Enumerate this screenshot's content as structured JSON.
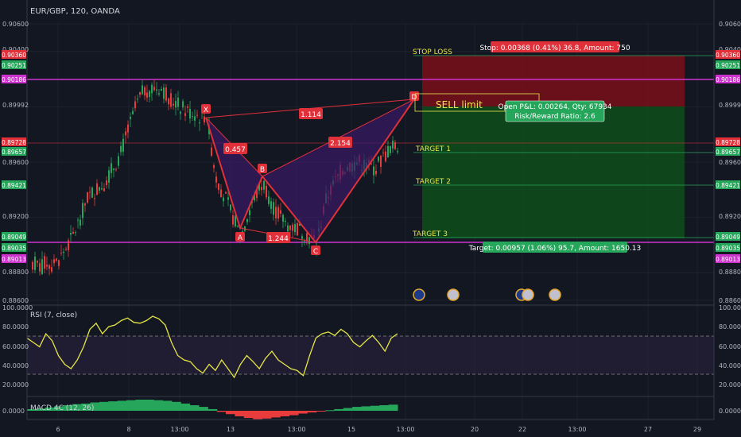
{
  "header": {
    "symbol_title": "EUR/GBP, 120, OANDA"
  },
  "colors": {
    "background": "#131722",
    "up_candle": "#26a65b",
    "down_candle": "#e83c3c",
    "pattern": "#e0303a",
    "pattern_fill": "#3a1a66",
    "magenta": "#cc33cc",
    "stop_zone": "#7a0f1a",
    "target_zone": "#0f4d1a",
    "rsi": "#e6e645",
    "rsi_band": "#2a1f3d",
    "target_text": "#e6e645",
    "grid": "#1e222d"
  },
  "price_axis": {
    "ticks": [
      "0.90600",
      "0.90400",
      "0.89992",
      "0.89600",
      "0.89200",
      "0.88800",
      "0.88600"
    ],
    "left_ticks": [
      "0.90600",
      "0.90400",
      "0.89992",
      "0.89600",
      "0.89200",
      "0.88800",
      "0.88600"
    ],
    "badges": [
      {
        "label": "0.90360",
        "color": "#e0303a",
        "value": 0.9036
      },
      {
        "label": "0.90251",
        "color": "#26a65b",
        "value": 0.90251
      },
      {
        "label": "0.90186",
        "color": "#cc33cc",
        "value": 0.90186
      },
      {
        "label": "0.89728",
        "color": "#e0303a",
        "value": 0.89728
      },
      {
        "label": "0.89657",
        "color": "#26a65b",
        "value": 0.89657
      },
      {
        "label": "0.89421",
        "color": "#26a65b",
        "value": 0.89421
      },
      {
        "label": "0.89049",
        "color": "#26a65b",
        "value": 0.89049
      },
      {
        "label": "0.89035",
        "color": "#26a65b",
        "value": 0.89035
      },
      {
        "label": "0.89013",
        "color": "#cc33cc",
        "value": 0.89013
      }
    ]
  },
  "time_axis": {
    "ticks": [
      "6",
      "8",
      "13:00",
      "13",
      "13:00",
      "15",
      "13:00",
      "20",
      "22",
      "13:00",
      "27",
      "29",
      "13:00"
    ]
  },
  "chart_data": [
    {
      "type": "line",
      "title": "EUR/GBP, 120, OANDA",
      "pattern": {
        "points": [
          {
            "label": "X",
            "x": 12.7,
            "y": 0.8994
          },
          {
            "label": "A",
            "x": 13.3,
            "y": 0.8906
          },
          {
            "label": "B",
            "x": 13.7,
            "y": 0.8945
          },
          {
            "label": "C",
            "x": 15.3,
            "y": 0.8901
          },
          {
            "label": "D",
            "x": 18.3,
            "y": 0.9011
          }
        ],
        "ratios": [
          "1.114",
          "0.457",
          "2.154",
          "1.244"
        ]
      },
      "trade": {
        "order_label": "SELL limit",
        "stop_loss_label": "STOP LOSS",
        "stop_info": "Stop: 0.00368 (0.41%) 36.8, Amount: 750",
        "pnl_info": "Open P&L: 0.00264, Qty: 67934",
        "rr_info": "Risk/Reward Ratio: 2.6",
        "target_info": "Target: 0.00957 (1.06%) 95.7, Amount: 1650.13",
        "target_labels": [
          "TARGET 1",
          "TARGET 2",
          "TARGET 3"
        ]
      },
      "horizontal_levels": [
        0.90186,
        0.89728,
        0.89013
      ]
    },
    {
      "type": "line",
      "title": "RSI (7, close)",
      "ylim": [
        0,
        100
      ],
      "y_ticks": [
        "100.0000",
        "80.0000",
        "60.0000",
        "40.0000",
        "20.0000"
      ],
      "bands": [
        30,
        70
      ],
      "values": [
        65,
        60,
        55,
        70,
        62,
        45,
        35,
        30,
        40,
        55,
        75,
        82,
        70,
        78,
        80,
        85,
        88,
        83,
        82,
        85,
        90,
        87,
        80,
        60,
        45,
        40,
        38,
        30,
        25,
        35,
        28,
        40,
        30,
        20,
        35,
        45,
        38,
        30,
        42,
        50,
        40,
        35,
        30,
        28,
        22,
        45,
        65,
        70,
        72,
        68,
        75,
        70,
        60,
        55,
        62,
        68,
        60,
        50,
        65,
        70
      ]
    },
    {
      "type": "bar",
      "title": "MACD 4C (12, 26)",
      "y_ticks": [
        "0.0000"
      ],
      "values": [
        0.3,
        0.4,
        0.6,
        0.8,
        1.0,
        1.2,
        1.3,
        1.5,
        1.6,
        1.7,
        1.8,
        1.9,
        2.0,
        2.0,
        1.9,
        1.8,
        1.6,
        1.3,
        1.0,
        0.7,
        0.3,
        -0.2,
        -0.6,
        -1.0,
        -1.3,
        -1.5,
        -1.4,
        -1.2,
        -1.0,
        -0.8,
        -0.5,
        -0.3,
        -0.1,
        0.1,
        0.3,
        0.5,
        0.7,
        0.8,
        0.9,
        1.0,
        1.1
      ]
    }
  ]
}
